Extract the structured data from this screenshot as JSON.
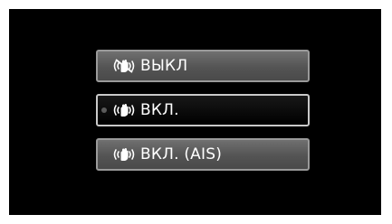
{
  "menu": {
    "options": [
      {
        "label": "ВЫКЛ",
        "icon": "hand-shake-off-icon",
        "selected": false
      },
      {
        "label": "ВКЛ.",
        "icon": "hand-shake-on-icon",
        "selected": true
      },
      {
        "label": "ВКЛ. (AIS)",
        "icon": "hand-shake-on-icon",
        "selected": false
      }
    ]
  }
}
